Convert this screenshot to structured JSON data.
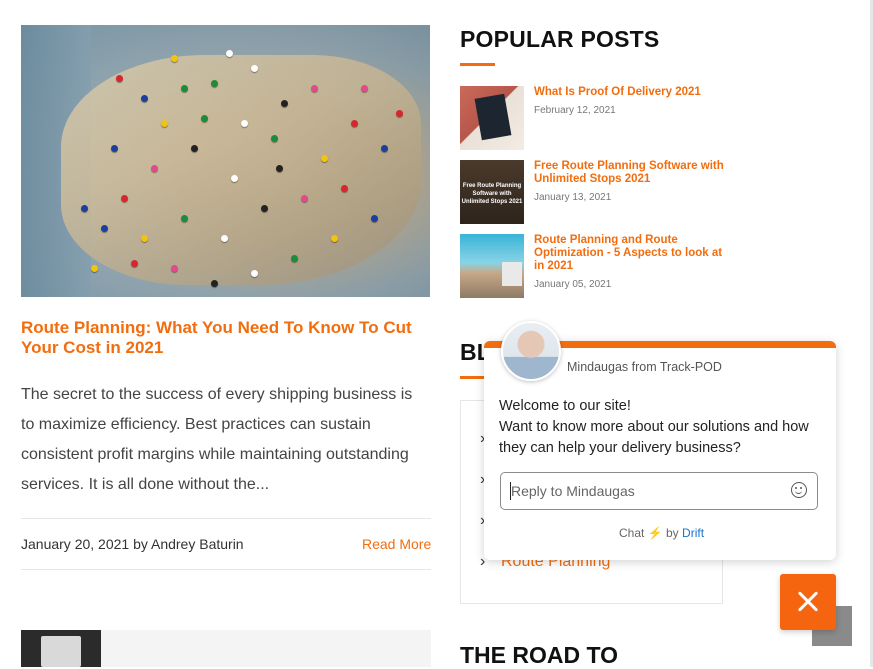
{
  "main_post": {
    "image_alt": "Map with pins",
    "title": "Route Planning: What You Need To Know To Cut Your Cost in 2021",
    "excerpt": "The secret to the success of every shipping business is to maximize efficiency. Best practices can sustain consistent profit margins while maintaining outstanding services. It is all done without the...",
    "meta": "January 20, 2021 by Andrey Baturin",
    "read_more": "Read More"
  },
  "popular_posts": {
    "heading": "POPULAR POSTS",
    "items": [
      {
        "title": "What Is Proof Of Delivery 2021",
        "date": "February 12, 2021"
      },
      {
        "title": "Free Route Planning Software with Unlimited Stops 2021",
        "date": "January 13, 2021",
        "thumb_text": "Free Route Planning Software with Unlimited Stops 2021"
      },
      {
        "title": "Route Planning and Route Optimization - 5 Aspects to look at in 2021",
        "date": "January 05, 2021"
      }
    ]
  },
  "categories": {
    "heading_partial": "BL",
    "visible_link": "Route Planning"
  },
  "chat": {
    "agent": "Mindaugas from Track-POD",
    "message_line1": "Welcome to our site!",
    "message_line2": "Want to know more about our solutions and how they can help your delivery business?",
    "reply_placeholder": "Reply to Mindaugas",
    "powered_prefix": "Chat",
    "powered_by": "by",
    "powered_brand": "Drift"
  },
  "next_widget": {
    "heading_partial": "THE ROAD TO"
  },
  "colors": {
    "accent": "#f26d0f",
    "link_blue": "#1a73c9"
  }
}
